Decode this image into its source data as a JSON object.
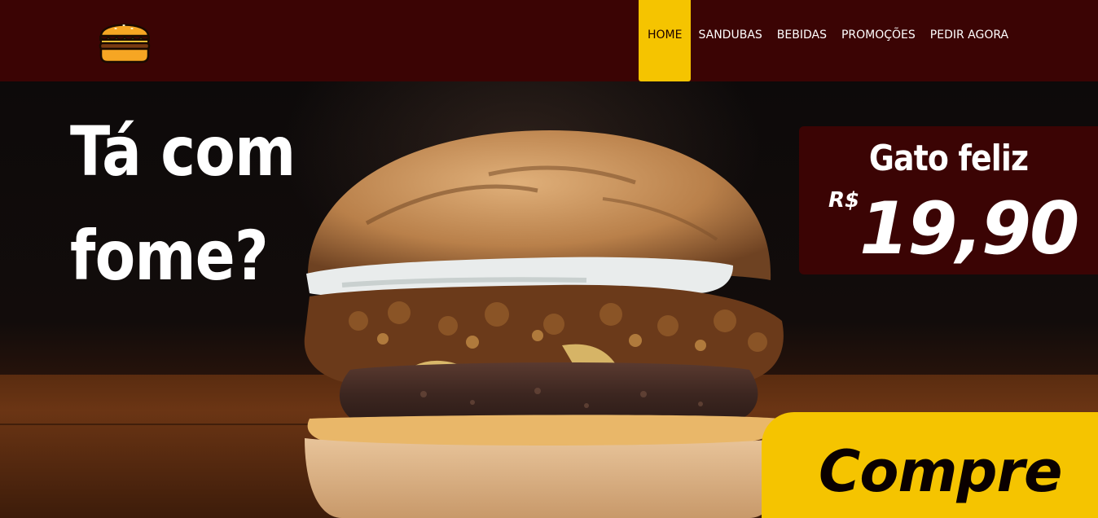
{
  "brand": {
    "logo_icon": "burger-icon"
  },
  "nav": {
    "items": [
      {
        "label": "HOME",
        "active": true
      },
      {
        "label": "SANDUBAS",
        "active": false
      },
      {
        "label": "BEBIDAS",
        "active": false
      },
      {
        "label": "PROMOÇÕES",
        "active": false
      },
      {
        "label": "PEDIR AGORA",
        "active": false
      }
    ]
  },
  "hero": {
    "headline_line1": "Tá com",
    "headline_line2": "fome?",
    "image": "burger-photo"
  },
  "promo": {
    "name": "Gato feliz",
    "currency": "R$",
    "price": "19,90"
  },
  "cta": {
    "label": "Compre"
  },
  "colors": {
    "header_bg": "#3b0404",
    "accent": "#f5c400",
    "text_light": "#ffffff",
    "text_dark": "#0a0000"
  }
}
